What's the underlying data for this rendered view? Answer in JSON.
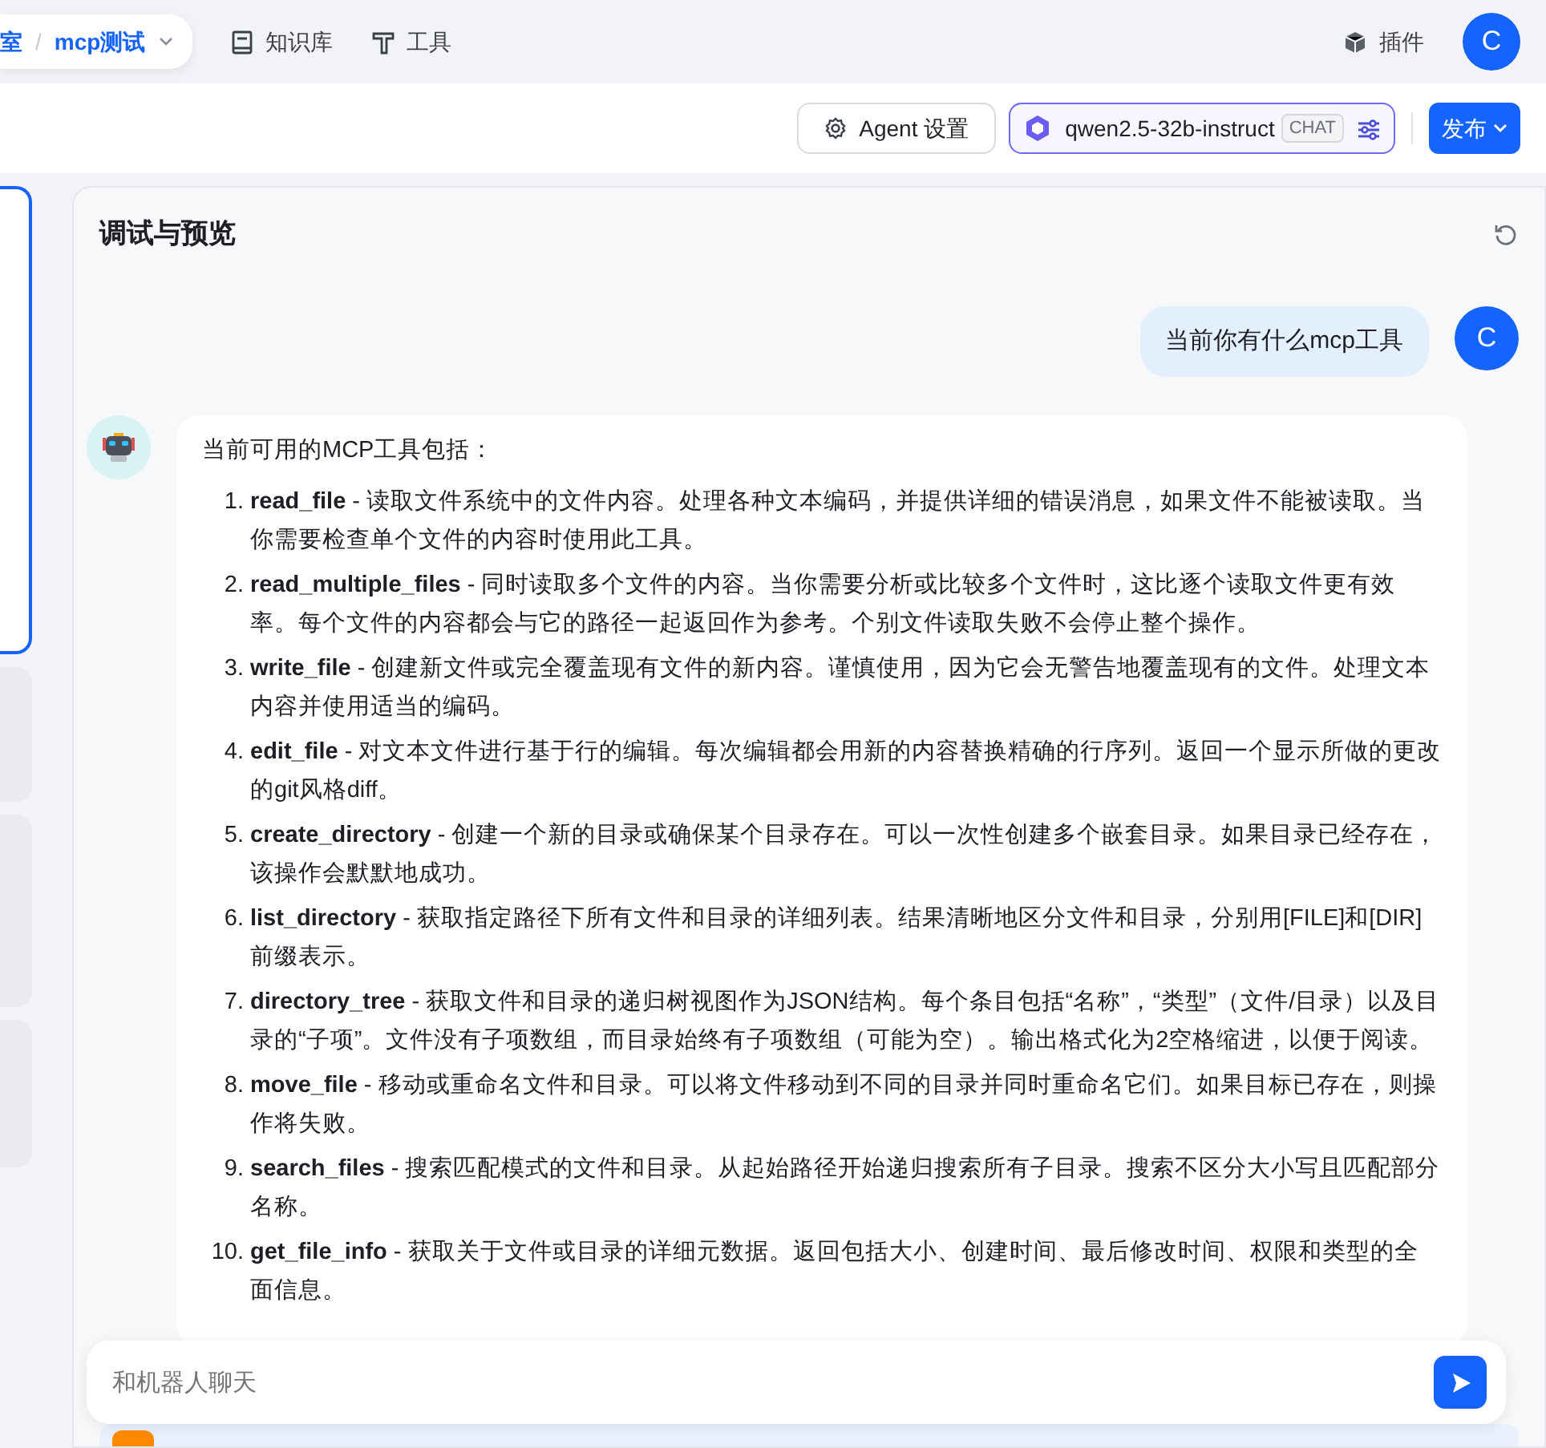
{
  "breadcrumb": {
    "parent": "室",
    "separator": "/",
    "current": "mcp测试"
  },
  "nav": [
    {
      "label": "知识库"
    },
    {
      "label": "工具"
    }
  ],
  "plugins": {
    "label": "插件"
  },
  "account": {
    "initial": "C"
  },
  "toolbar": {
    "settings": "Agent 设置",
    "model": "qwen2.5-32b-instruct",
    "model_tag": "CHAT",
    "publish": "发布"
  },
  "preview": {
    "title": "调试与预览",
    "user_message": {
      "text": "当前你有什么mcp工具",
      "initial": "C"
    },
    "bot_message": {
      "intro": "当前可用的MCP工具包括：",
      "items": [
        {
          "number": "1.",
          "text": "**read_file** - 读取文件系统中的文件内容。处理各种文本编码，并提供详细的错误消息，如果文件不能被读取。当你需要检查单个文件的内容时使用此工具。"
        },
        {
          "number": "2.",
          "text": "**read_multiple_files** - 同时读取多个文件的内容。当你需要分析或比较多个文件时，这比逐个读取文件更有效率。每个文件的内容都会与它的路径一起返回作为参考。个别文件读取失败不会停止整个操作。"
        },
        {
          "number": "3.",
          "text": "**write_file** - 创建新文件或完全覆盖现有文件的新内容。谨慎使用，因为它会无警告地覆盖现有的文件。处理文本内容并使用适当的编码。"
        },
        {
          "number": "4.",
          "text": "**edit_file** - 对文本文件进行基于行的编辑。每次编辑都会用新的内容替换精确的行序列。返回一个显示所做的更改的git风格diff。"
        },
        {
          "number": "5.",
          "text": "**create_directory** - 创建一个新的目录或确保某个目录存在。可以一次性创建多个嵌套目录。如果目录已经存在，该操作会默默地成功。"
        },
        {
          "number": "6.",
          "text": "**list_directory** - 获取指定路径下所有文件和目录的详细列表。结果清晰地区分文件和目录，分别用[FILE]和[DIR]前缀表示。"
        },
        {
          "number": "7.",
          "text": "**directory_tree** - 获取文件和目录的递归树视图作为JSON结构。每个条目包括“名称”，“类型”（文件/目录）以及目录的“子项”。文件没有子项数组，而目录始终有子项数组（可能为空）。输出格式化为2空格缩进，以便于阅读。"
        },
        {
          "number": "8.",
          "text": "**move_file** - 移动或重命名文件和目录。可以将文件移动到不同的目录并同时重命名它们。如果目标已存在，则操作将失败。"
        },
        {
          "number": "9.",
          "text": "**search_files** - 搜索匹配模式的文件和目录。从起始路径开始递归搜索所有子目录。搜索不区分大小写且匹配部分名称。"
        },
        {
          "number": "10.",
          "text": "**get_file_info** - 获取关于文件或目录的详细元数据。返回包括大小、创建时间、最后修改时间、权限和类型的全面信息。"
        }
      ]
    },
    "input": {
      "placeholder": "和机器人聊天"
    }
  }
}
